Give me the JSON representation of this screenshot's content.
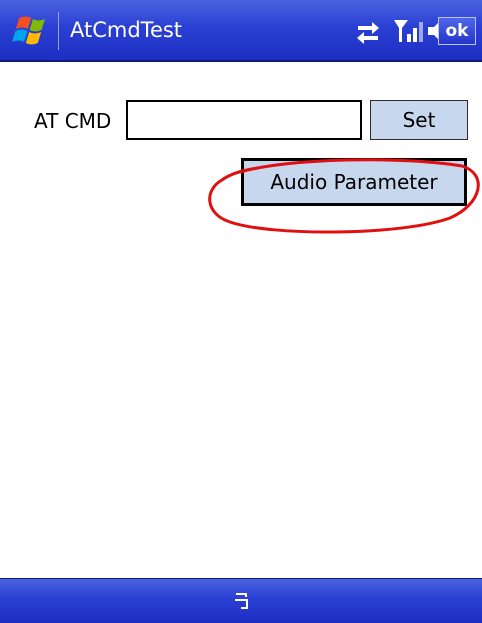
{
  "title_bar": {
    "app_title": "AtCmdTest",
    "start_icon": "windows-flag-icon",
    "status_icons": [
      "sync-icon",
      "signal-icon",
      "volume-icon"
    ],
    "ok_label": "ok"
  },
  "form": {
    "at_label": "AT CMD",
    "at_value": "",
    "set_label": "Set",
    "audio_label": "Audio Parameter"
  },
  "menu_bar": {
    "icon": "keyboard-icon"
  },
  "colors": {
    "bar_blue": "#2a3fd3",
    "button_fill": "#c7d8ee",
    "highlight_red": "#e01010"
  }
}
